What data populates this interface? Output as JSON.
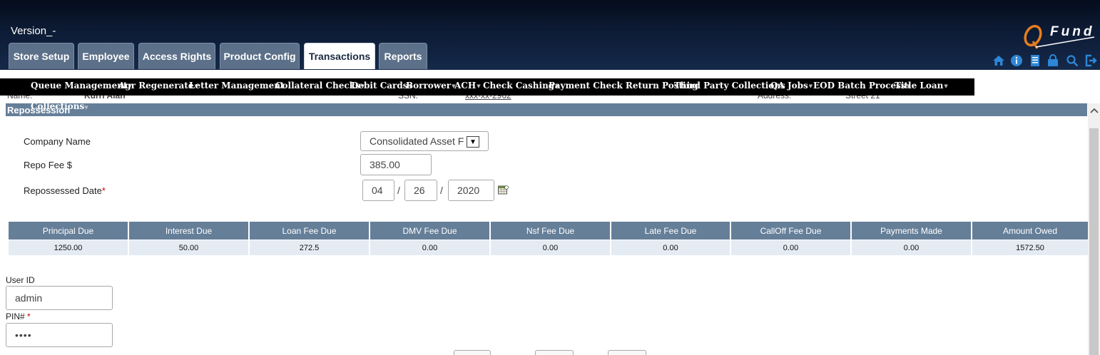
{
  "header": {
    "version": "Version_-",
    "tabs": [
      {
        "label": "Store Setup",
        "active": false
      },
      {
        "label": "Employee",
        "active": false
      },
      {
        "label": "Access Rights",
        "active": false
      },
      {
        "label": "Product Config",
        "active": false
      },
      {
        "label": "Transactions",
        "active": true
      },
      {
        "label": "Reports",
        "active": false
      }
    ],
    "logo_text": "Fund",
    "icons": [
      "home-icon",
      "info-icon",
      "notes-icon",
      "lock-icon",
      "search-icon",
      "logout-icon"
    ],
    "accent_color": "#e87d1e"
  },
  "menu": {
    "items": [
      {
        "label": "Queue Management"
      },
      {
        "label": "Agr Regenerate"
      },
      {
        "label": "Letter Management"
      },
      {
        "label": "Collateral Checks"
      },
      {
        "label": "Debit Cards"
      },
      {
        "label": "Borrower"
      },
      {
        "label": "ACH"
      },
      {
        "label": "Check Cashing"
      },
      {
        "label": "Payment Check Return Posting"
      },
      {
        "label": "Third Party Collections"
      },
      {
        "label": "QA Jobs"
      },
      {
        "label": "EOD Batch Process"
      },
      {
        "label": "Title Loan"
      }
    ],
    "second_row": "Collections"
  },
  "customer_info": {
    "name_label": "Name:",
    "name_value": "Kurri Alan",
    "ssn_label": "SSN:",
    "ssn_value": "xxx-xx-2962",
    "address_label": "Address:",
    "address_value": "Street 21"
  },
  "section": {
    "title": "Repossession"
  },
  "form": {
    "company_label": "Company Name",
    "company_value": "Consolidated Asset F",
    "repo_fee_label": "Repo Fee $",
    "repo_fee_value": "385.00",
    "date_label": "Repossessed Date",
    "date_required": "*",
    "date_month": "04",
    "date_day": "26",
    "date_year": "2020",
    "date_sep": "/"
  },
  "table": {
    "headers": [
      "Principal Due",
      "Interest Due",
      "Loan Fee Due",
      "DMV Fee Due",
      "Nsf Fee Due",
      "Late Fee Due",
      "CallOff Fee Due",
      "Payments Made",
      "Amount Owed"
    ],
    "row": [
      "1250.00",
      "50.00",
      "272.5",
      "0.00",
      "0.00",
      "0.00",
      "0.00",
      "0.00",
      "1572.50"
    ]
  },
  "auth": {
    "user_label": "User ID",
    "user_value": "admin",
    "pin_label": "PIN#",
    "pin_required": "*",
    "pin_value": "••••"
  }
}
